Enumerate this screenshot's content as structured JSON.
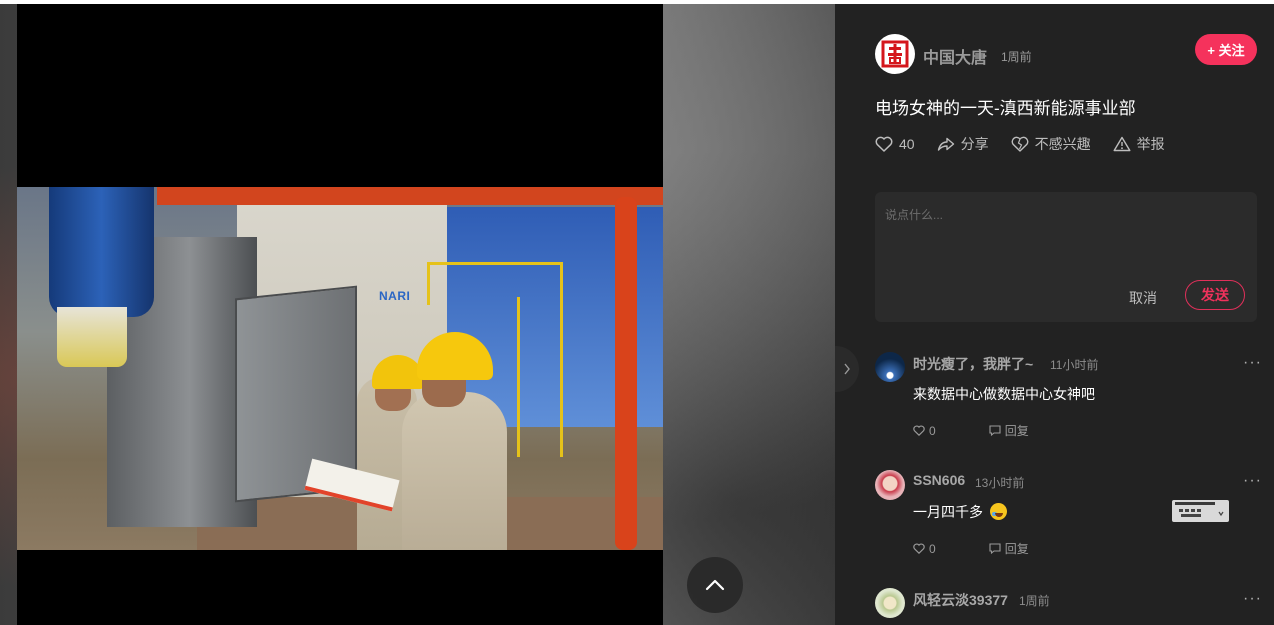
{
  "viewer": {
    "photo_brand": "NARI",
    "scroll_up_icon": "chevron-up-icon",
    "collapse_icon": "chevron-right-icon"
  },
  "post": {
    "author": "中国大唐",
    "time": "1周前",
    "follow_label": "+ 关注",
    "title": "电场女神的一天-滇西新能源事业部",
    "likes": "40",
    "share_label": "分享",
    "dislike_label": "不感兴趣",
    "report_label": "举报"
  },
  "comment_box": {
    "placeholder": "说点什么...",
    "cancel_label": "取消",
    "send_label": "发送"
  },
  "comments": [
    {
      "name": "时光瘦了，我胖了~",
      "time": "11小时前",
      "text": "来数据中心做数据中心女神吧",
      "likes": "0",
      "reply_label": "回复"
    },
    {
      "name": "SSN606",
      "time": "13小时前",
      "text": "一月四千多",
      "likes": "0",
      "reply_label": "回复"
    },
    {
      "name": "风轻云淡39377",
      "time": "1周前"
    }
  ],
  "colors": {
    "accent": "#f5325c",
    "panel_bg": "#222222"
  }
}
